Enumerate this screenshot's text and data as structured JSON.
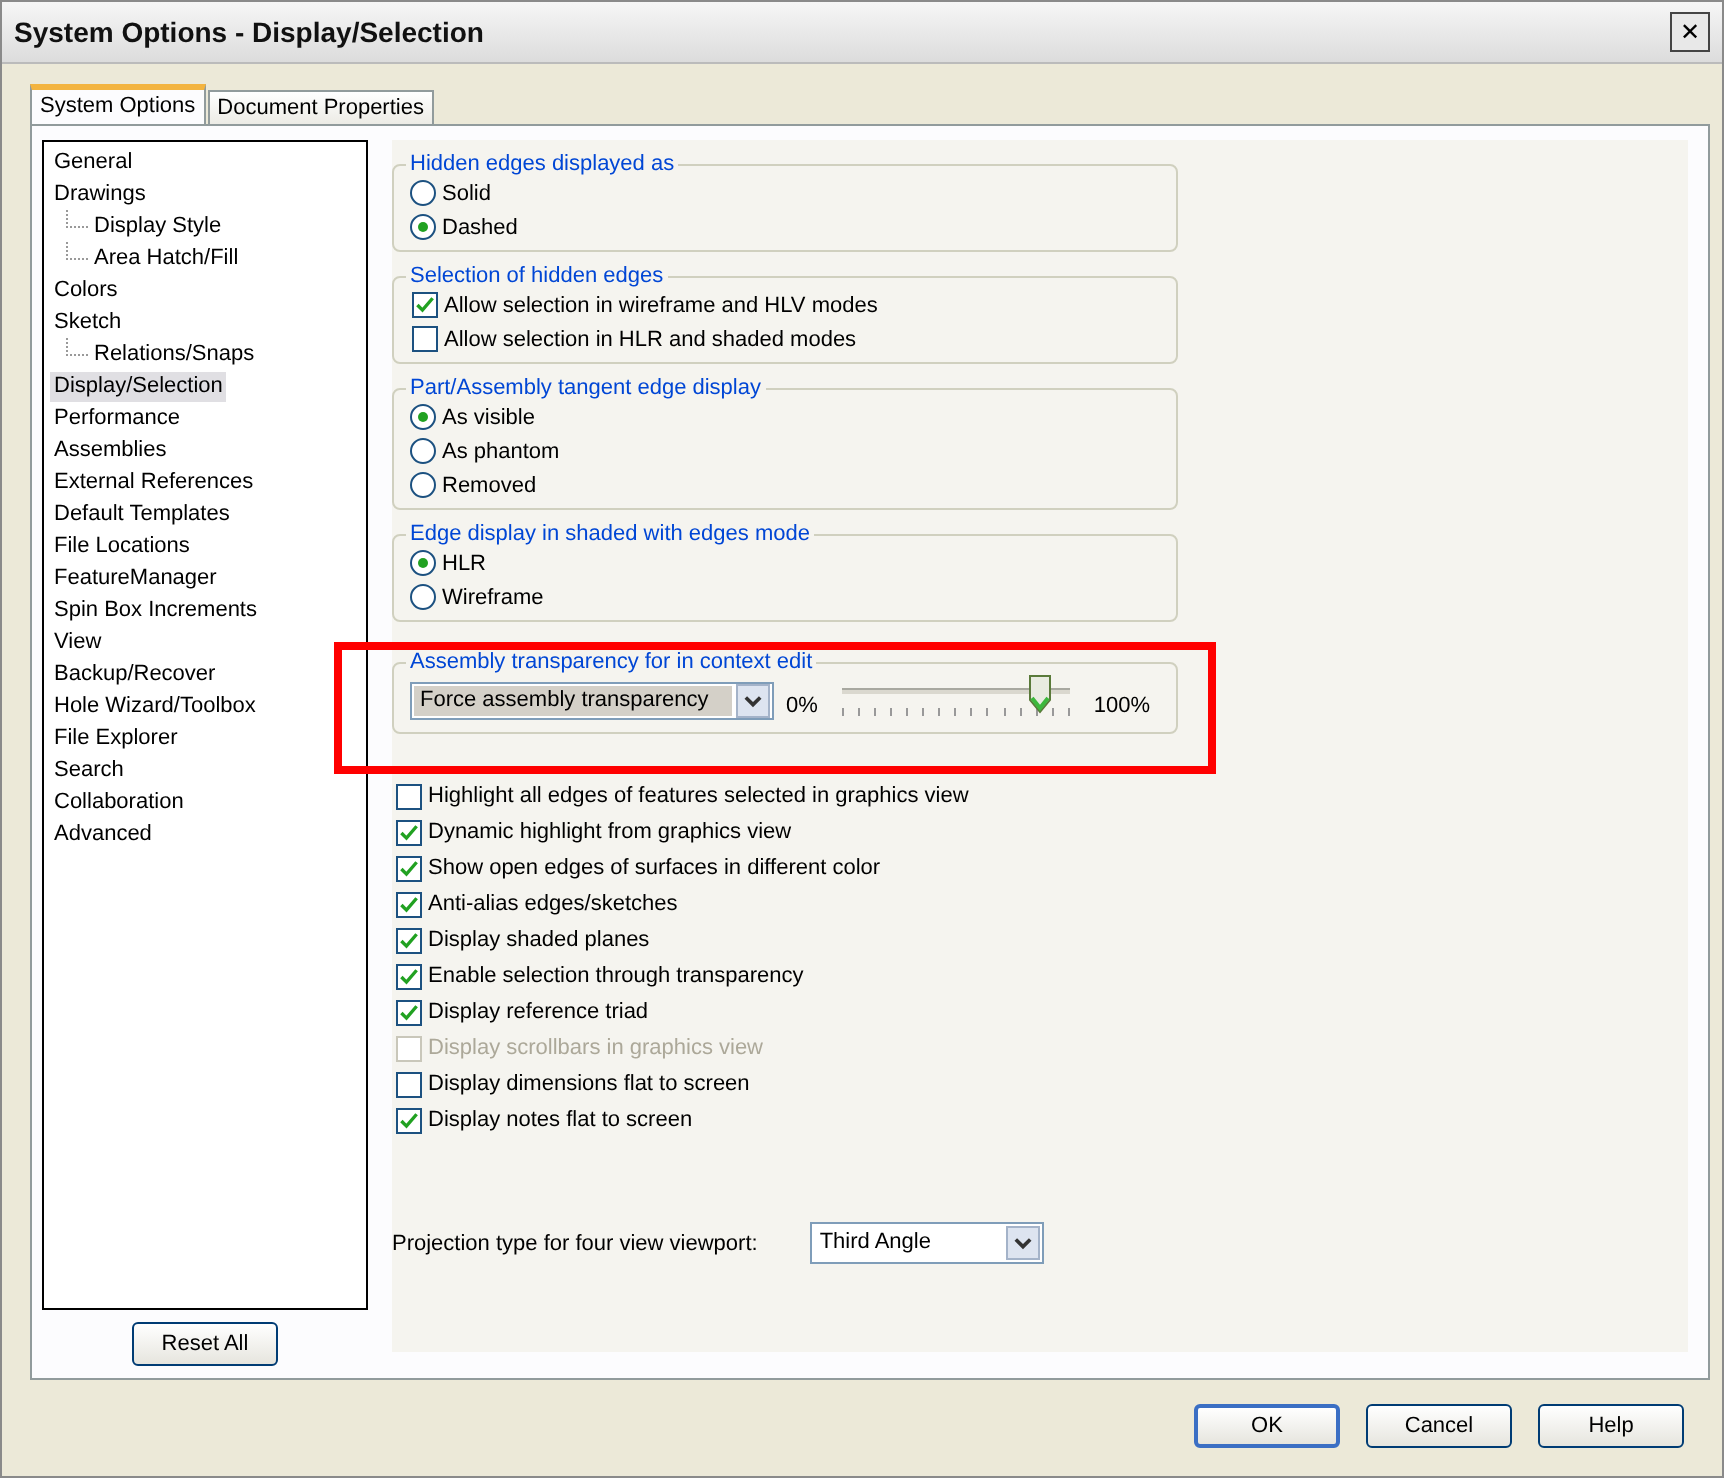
{
  "window": {
    "title": "System Options - Display/Selection",
    "close": "✕"
  },
  "tabs": [
    {
      "label": "System Options",
      "selected": true
    },
    {
      "label": "Document Properties",
      "selected": false
    }
  ],
  "tree": [
    {
      "label": "General",
      "selected": false
    },
    {
      "label": "Drawings",
      "selected": false,
      "children": [
        {
          "label": "Display Style",
          "selected": false
        },
        {
          "label": "Area Hatch/Fill",
          "selected": false
        }
      ]
    },
    {
      "label": "Colors",
      "selected": false
    },
    {
      "label": "Sketch",
      "selected": false,
      "children": [
        {
          "label": "Relations/Snaps",
          "selected": false
        }
      ]
    },
    {
      "label": "Display/Selection",
      "selected": true
    },
    {
      "label": "Performance",
      "selected": false
    },
    {
      "label": "Assemblies",
      "selected": false
    },
    {
      "label": "External References",
      "selected": false
    },
    {
      "label": "Default Templates",
      "selected": false
    },
    {
      "label": "File Locations",
      "selected": false
    },
    {
      "label": "FeatureManager",
      "selected": false
    },
    {
      "label": "Spin Box Increments",
      "selected": false
    },
    {
      "label": "View",
      "selected": false
    },
    {
      "label": "Backup/Recover",
      "selected": false
    },
    {
      "label": "Hole Wizard/Toolbox",
      "selected": false
    },
    {
      "label": "File Explorer",
      "selected": false
    },
    {
      "label": "Search",
      "selected": false
    },
    {
      "label": "Collaboration",
      "selected": false
    },
    {
      "label": "Advanced",
      "selected": false
    }
  ],
  "reset_button": "Reset All",
  "groups": [
    {
      "kind": "radio",
      "title": "Hidden edges displayed as",
      "items": [
        {
          "label": "Solid",
          "selected": false
        },
        {
          "label": "Dashed",
          "selected": true
        }
      ]
    },
    {
      "kind": "checkbox",
      "title": "Selection of hidden edges",
      "items": [
        {
          "label": "Allow selection in wireframe and HLV modes",
          "checked": true
        },
        {
          "label": "Allow selection in HLR and shaded modes",
          "checked": false
        }
      ]
    },
    {
      "kind": "radio",
      "title": "Part/Assembly tangent edge display",
      "items": [
        {
          "label": "As visible",
          "selected": true
        },
        {
          "label": "As phantom",
          "selected": false
        },
        {
          "label": "Removed",
          "selected": false
        }
      ]
    },
    {
      "kind": "radio",
      "title": "Edge display in shaded with edges mode",
      "items": [
        {
          "label": "HLR",
          "selected": true
        },
        {
          "label": "Wireframe",
          "selected": false
        }
      ]
    },
    {
      "kind": "transparency",
      "title": "Assembly transparency for in context edit",
      "dropdown": "Force assembly transparency",
      "min_label": "0%",
      "max_label": "100%",
      "level": 0.87
    }
  ],
  "options": [
    {
      "label": "Highlight all edges of features selected in graphics view",
      "checked": false,
      "disabled": false
    },
    {
      "label": "Dynamic highlight from graphics view",
      "checked": true,
      "disabled": false
    },
    {
      "label": "Show open edges of surfaces in different color",
      "checked": true,
      "disabled": false
    },
    {
      "label": "Anti-alias edges/sketches",
      "checked": true,
      "disabled": false
    },
    {
      "label": "Display shaded planes",
      "checked": true,
      "disabled": false
    },
    {
      "label": "Enable selection through transparency",
      "checked": true,
      "disabled": false
    },
    {
      "label": "Display reference triad",
      "checked": true,
      "disabled": false
    },
    {
      "label": "Display scrollbars in graphics view",
      "checked": false,
      "disabled": true
    },
    {
      "label": "Display dimensions flat to screen",
      "checked": false,
      "disabled": false
    },
    {
      "label": "Display notes flat to screen",
      "checked": true,
      "disabled": false
    }
  ],
  "projection": {
    "label": "Projection type for four view viewport:",
    "value": "Third Angle"
  },
  "buttons": [
    "OK",
    "Cancel",
    "Help"
  ]
}
